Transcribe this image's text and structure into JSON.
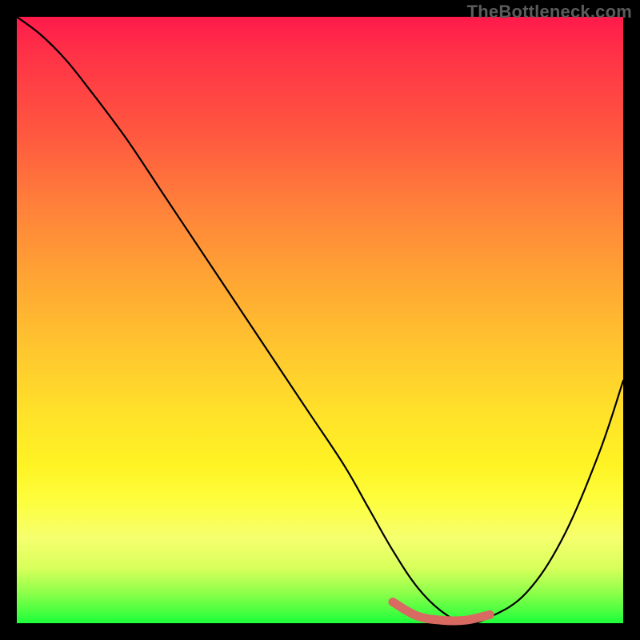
{
  "watermark": "TheBottleneck.com",
  "chart_data": {
    "type": "line",
    "title": "",
    "xlabel": "",
    "ylabel": "",
    "xlim": [
      0,
      100
    ],
    "ylim": [
      0,
      100
    ],
    "grid": false,
    "legend": false,
    "background_gradient": {
      "top": "#ff1a4b",
      "mid": "#ffe329",
      "bottom": "#1dff3a"
    },
    "series": [
      {
        "name": "bottleneck-curve",
        "color": "#000000",
        "x": [
          0,
          4,
          8,
          12,
          18,
          24,
          30,
          36,
          42,
          48,
          54,
          58,
          62,
          66,
          70,
          74,
          78,
          84,
          90,
          96,
          100
        ],
        "y": [
          100,
          97,
          93,
          88,
          80,
          71,
          62,
          53,
          44,
          35,
          26,
          19,
          12,
          6,
          2,
          0,
          1,
          5,
          14,
          28,
          40
        ]
      },
      {
        "name": "optimal-region",
        "color": "#d86a62",
        "style": "thick",
        "x": [
          62,
          66,
          70,
          74,
          78
        ],
        "y": [
          3.5,
          1.2,
          0.5,
          0.5,
          1.4
        ]
      }
    ],
    "notes": "Bathtub-style bottleneck curve over rainbow gradient; thick salmon segment marks the low-bottleneck sweet spot."
  }
}
